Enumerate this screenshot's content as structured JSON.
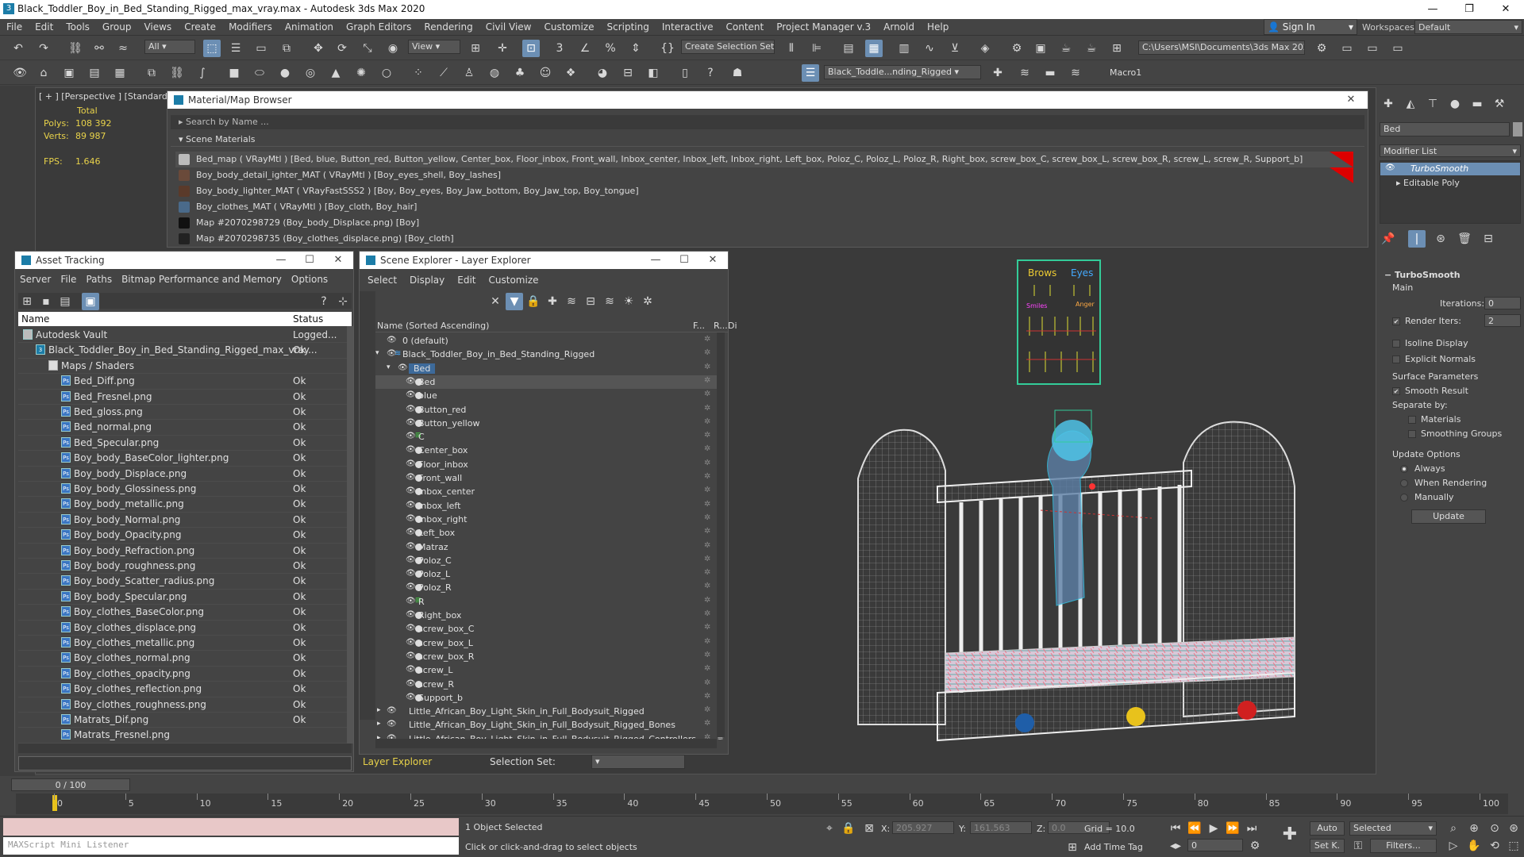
{
  "titlebar": {
    "title": "Black_Toddler_Boy_in_Bed_Standing_Rigged_max_vray.max - Autodesk 3ds Max 2020"
  },
  "menu": [
    "File",
    "Edit",
    "Tools",
    "Group",
    "Views",
    "Create",
    "Modifiers",
    "Animation",
    "Graph Editors",
    "Rendering",
    "Civil View",
    "Customize",
    "Scripting",
    "Interactive",
    "Content",
    "Project Manager v.3",
    "Arnold",
    "Help"
  ],
  "account": {
    "signin": "Sign In",
    "workspaces_label": "Workspaces:",
    "workspace": "Default"
  },
  "toolbar": {
    "filter": "All",
    "view": "View",
    "selection_set": "Create Selection Set",
    "path": "C:\\Users\\MSI\\Documents\\3ds Max 2020",
    "scene_name": "Black_Toddle...nding_Rigged",
    "macro": "Macro1"
  },
  "viewport": {
    "label": "[ + ] [Perspective ] [Standard ] [",
    "stats": {
      "total": "Total",
      "polys_label": "Polys:",
      "polys": "108 392",
      "verts_label": "Verts:",
      "verts": "89 987",
      "fps_label": "FPS:",
      "fps": "1.646"
    },
    "poster": {
      "brows": "Brows",
      "eyes": "Eyes",
      "smiles": "Smiles",
      "anger": "Anger"
    },
    "bg": "#3a3a3a"
  },
  "mmb": {
    "title": "Material/Map Browser",
    "search": "Search by Name ...",
    "section": "Scene Materials",
    "rows": [
      {
        "text": "Bed_map  ( VRayMtl )  [Bed, blue, Button_red, Button_yellow, Center_box, Floor_inbox, Front_wall, Inbox_center, Inbox_left, Inbox_right, Left_box, Poloz_C, Poloz_L, Poloz_R, Right_box, screw_box_C, screw_box_L, screw_box_R, screw_L, screw_R, Support_b]",
        "swatch": "#bbbbbb",
        "flag": true
      },
      {
        "text": "Boy_body_detail_ighter_MAT  ( VRayMtl )  [Boy_eyes_shell, Boy_lashes]",
        "swatch": "#6a4a3a",
        "flag": true
      },
      {
        "text": "Boy_body_lighter_MAT  ( VRayFastSSS2 )  [Boy, Boy_eyes, Boy_Jaw_bottom, Boy_Jaw_top, Boy_tongue]",
        "swatch": "#5a3a2a",
        "flag": false
      },
      {
        "text": "Boy_clothes_MAT  ( VRayMtl )  [Boy_cloth, Boy_hair]",
        "swatch": "#4a6a8a",
        "flag": false
      },
      {
        "text": "Map #2070298729 (Boy_body_Displace.png)  [Boy]",
        "swatch": "#111111",
        "flag": false
      },
      {
        "text": "Map #2070298735 (Boy_clothes_displace.png)  [Boy_cloth]",
        "swatch": "#222222",
        "flag": false
      }
    ]
  },
  "asset": {
    "title": "Asset Tracking",
    "menu": [
      "Server",
      "File",
      "Paths",
      "Bitmap Performance and Memory",
      "Options"
    ],
    "col_name": "Name",
    "col_status": "Status",
    "rows": [
      {
        "name": "Autodesk Vault",
        "status": "Logged...",
        "indent": 0
      },
      {
        "name": "Black_Toddler_Boy_in_Bed_Standing_Rigged_max_vray...",
        "status": "Ok",
        "indent": 1
      },
      {
        "name": "Maps / Shaders",
        "status": "",
        "indent": 2
      },
      {
        "name": "Bed_Diff.png",
        "status": "Ok",
        "indent": 3
      },
      {
        "name": "Bed_Fresnel.png",
        "status": "Ok",
        "indent": 3
      },
      {
        "name": "Bed_gloss.png",
        "status": "Ok",
        "indent": 3
      },
      {
        "name": "Bed_normal.png",
        "status": "Ok",
        "indent": 3
      },
      {
        "name": "Bed_Specular.png",
        "status": "Ok",
        "indent": 3
      },
      {
        "name": "Boy_body_BaseColor_lighter.png",
        "status": "Ok",
        "indent": 3
      },
      {
        "name": "Boy_body_Displace.png",
        "status": "Ok",
        "indent": 3
      },
      {
        "name": "Boy_body_Glossiness.png",
        "status": "Ok",
        "indent": 3
      },
      {
        "name": "Boy_body_metallic.png",
        "status": "Ok",
        "indent": 3
      },
      {
        "name": "Boy_body_Normal.png",
        "status": "Ok",
        "indent": 3
      },
      {
        "name": "Boy_body_Opacity.png",
        "status": "Ok",
        "indent": 3
      },
      {
        "name": "Boy_body_Refraction.png",
        "status": "Ok",
        "indent": 3
      },
      {
        "name": "Boy_body_roughness.png",
        "status": "Ok",
        "indent": 3
      },
      {
        "name": "Boy_body_Scatter_radius.png",
        "status": "Ok",
        "indent": 3
      },
      {
        "name": "Boy_body_Specular.png",
        "status": "Ok",
        "indent": 3
      },
      {
        "name": "Boy_clothes_BaseColor.png",
        "status": "Ok",
        "indent": 3
      },
      {
        "name": "Boy_clothes_displace.png",
        "status": "Ok",
        "indent": 3
      },
      {
        "name": "Boy_clothes_metallic.png",
        "status": "Ok",
        "indent": 3
      },
      {
        "name": "Boy_clothes_normal.png",
        "status": "Ok",
        "indent": 3
      },
      {
        "name": "Boy_clothes_opacity.png",
        "status": "Ok",
        "indent": 3
      },
      {
        "name": "Boy_clothes_reflection.png",
        "status": "Ok",
        "indent": 3
      },
      {
        "name": "Boy_clothes_roughness.png",
        "status": "Ok",
        "indent": 3
      },
      {
        "name": "Matrats_Dif.png",
        "status": "Ok",
        "indent": 3
      },
      {
        "name": "Matrats_Fresnel.png",
        "status": "",
        "indent": 3
      }
    ]
  },
  "scene": {
    "title": "Scene Explorer - Layer Explorer",
    "menu": [
      "Select",
      "Display",
      "Edit",
      "Customize"
    ],
    "col_name": "Name (Sorted Ascending)",
    "col_f": "F...",
    "col_r": "R...",
    "col_d": "Di",
    "rows": [
      {
        "name": "0 (default)",
        "level": 0,
        "kind": "layer"
      },
      {
        "name": "Black_Toddler_Boy_in_Bed_Standing_Rigged",
        "level": 0,
        "kind": "layer-open"
      },
      {
        "name": "Bed",
        "level": 1,
        "kind": "group-sel"
      },
      {
        "name": "Bed",
        "level": 2,
        "kind": "obj-sel"
      },
      {
        "name": "blue",
        "level": 2,
        "kind": "obj"
      },
      {
        "name": "Button_red",
        "level": 2,
        "kind": "obj"
      },
      {
        "name": "Button_yellow",
        "level": 2,
        "kind": "obj"
      },
      {
        "name": "C",
        "level": 2,
        "kind": "ctl"
      },
      {
        "name": "Center_box",
        "level": 2,
        "kind": "obj"
      },
      {
        "name": "Floor_inbox",
        "level": 2,
        "kind": "obj"
      },
      {
        "name": "Front_wall",
        "level": 2,
        "kind": "obj"
      },
      {
        "name": "Inbox_center",
        "level": 2,
        "kind": "obj"
      },
      {
        "name": "Inbox_left",
        "level": 2,
        "kind": "obj"
      },
      {
        "name": "Inbox_right",
        "level": 2,
        "kind": "obj"
      },
      {
        "name": "Left_box",
        "level": 2,
        "kind": "obj"
      },
      {
        "name": "Matraz",
        "level": 2,
        "kind": "obj"
      },
      {
        "name": "Poloz_C",
        "level": 2,
        "kind": "obj"
      },
      {
        "name": "Poloz_L",
        "level": 2,
        "kind": "obj"
      },
      {
        "name": "Poloz_R",
        "level": 2,
        "kind": "obj"
      },
      {
        "name": "R",
        "level": 2,
        "kind": "ctl"
      },
      {
        "name": "Right_box",
        "level": 2,
        "kind": "obj"
      },
      {
        "name": "screw_box_C",
        "level": 2,
        "kind": "obj"
      },
      {
        "name": "screw_box_L",
        "level": 2,
        "kind": "obj"
      },
      {
        "name": "screw_box_R",
        "level": 2,
        "kind": "obj"
      },
      {
        "name": "screw_L",
        "level": 2,
        "kind": "obj"
      },
      {
        "name": "screw_R",
        "level": 2,
        "kind": "obj"
      },
      {
        "name": "Support_b",
        "level": 2,
        "kind": "obj"
      },
      {
        "name": "Little_African_Boy_Light_Skin_in_Full_Bodysuit_Rigged",
        "level": 0,
        "kind": "layer-closed"
      },
      {
        "name": "Little_African_Boy_Light_Skin_in_Full_Bodysuit_Rigged_Bones",
        "level": 0,
        "kind": "layer-closed"
      },
      {
        "name": "Little_African_Boy_Light_Skin_in_Full_Bodysuit_Rigged_Controllers",
        "level": 0,
        "kind": "layer-closed"
      }
    ],
    "footer": {
      "explorer": "Layer Explorer",
      "selection_set": "Selection Set:"
    }
  },
  "cmd": {
    "name": "Bed",
    "modifier_list": "Modifier List",
    "stack": [
      "TurboSmooth",
      "Editable Poly"
    ],
    "rollout": "TurboSmooth",
    "main": "Main",
    "iterations_label": "Iterations:",
    "iterations": "0",
    "render_iters_label": "Render Iters:",
    "render_iters": "2",
    "isoline": "Isoline Display",
    "explicit": "Explicit Normals",
    "surface": "Surface Parameters",
    "smooth": "Smooth Result",
    "separate": "Separate by:",
    "materials": "Materials",
    "smoothing": "Smoothing Groups",
    "update_options": "Update Options",
    "always": "Always",
    "when_rendering": "When Rendering",
    "manually": "Manually",
    "update": "Update"
  },
  "timeline": {
    "frame": "0 / 100",
    "ticks": [
      "0",
      "5",
      "10",
      "15",
      "20",
      "25",
      "30",
      "35",
      "40",
      "45",
      "50",
      "55",
      "60",
      "65",
      "70",
      "75",
      "80",
      "85",
      "90",
      "95",
      "100"
    ]
  },
  "status": {
    "maxscript": "MAXScript Mini Listener",
    "selected": "1 Object Selected",
    "hint": "Click or click-and-drag to select objects",
    "x_label": "X:",
    "x": "205.927",
    "y_label": "Y:",
    "y": "161.563",
    "z_label": "Z:",
    "z": "0.0",
    "grid": "Grid = 10.0",
    "auto": "Auto",
    "selected_dd": "Selected",
    "setk": "Set K.",
    "filters": "Filters...",
    "add_time_tag": "Add Time Tag",
    "frame_spinner": "0"
  }
}
